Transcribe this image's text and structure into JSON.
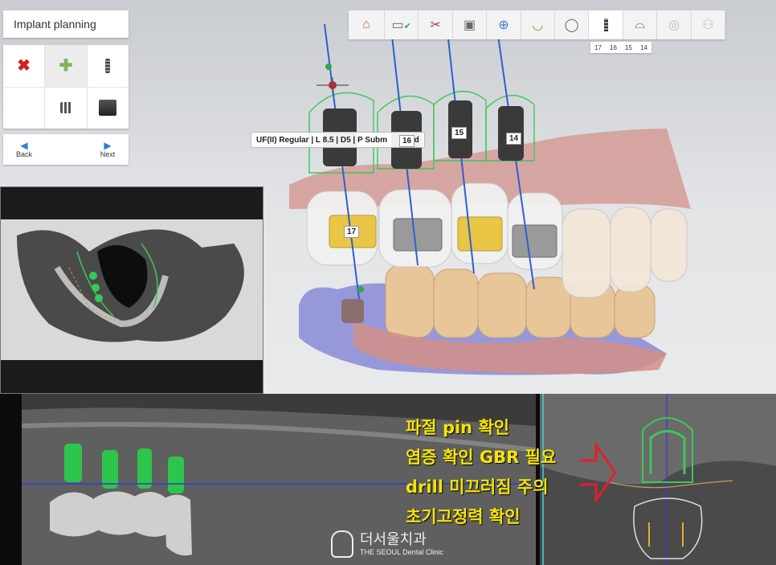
{
  "app": {
    "mode_title": "Implant planning"
  },
  "left_panel": {
    "tools": [
      {
        "icon": "delete-x-icon"
      },
      {
        "icon": "add-plus-icon"
      },
      {
        "icon": "single-implant-icon"
      },
      {
        "icon": "empty-slot"
      },
      {
        "icon": "multi-implant-icon"
      },
      {
        "icon": "abutment-icon"
      }
    ],
    "back_label": "Back",
    "next_label": "Next"
  },
  "workflow": {
    "steps": [
      {
        "icon": "home-icon"
      },
      {
        "icon": "scan-check-icon"
      },
      {
        "icon": "tools-icon"
      },
      {
        "icon": "window-icon"
      },
      {
        "icon": "crown-plus-icon"
      },
      {
        "icon": "arch-icon"
      },
      {
        "icon": "tooth-icon"
      },
      {
        "icon": "implant-icon",
        "active": true
      },
      {
        "icon": "guide-icon"
      },
      {
        "icon": "disc-icon"
      },
      {
        "icon": "people-icon"
      }
    ],
    "tooth_tabs": [
      "17",
      "16",
      "15",
      "14"
    ]
  },
  "viewport": {
    "implant_info": "UF(II) Regular | L 8.5 | D5 | P Subm",
    "implant_info_tail": "ed",
    "tooth_labels": [
      "16",
      "15",
      "14",
      "17"
    ]
  },
  "annotations": {
    "notes": [
      "파절 pin 확인",
      "염증 확인 GBR 필요",
      "drill 미끄러짐 주의",
      "초기고정력 확인"
    ],
    "arrow_color": "#e0202a",
    "note_color": "#f5e400"
  },
  "watermark": {
    "clinic_ko": "더서울치과",
    "clinic_en": "THE SEOUL Dental Clinic"
  },
  "colors": {
    "implant_axis": "#2f5fd0",
    "guide_outline": "#3cc85a",
    "gum": "#c98a8a",
    "crown_yellow": "#e9c646"
  }
}
